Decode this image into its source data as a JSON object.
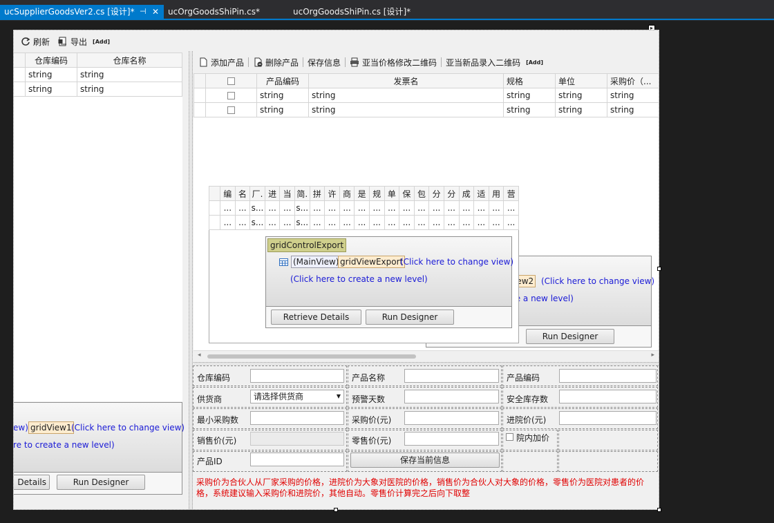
{
  "tabs": [
    {
      "label": "ucSupplierGoodsVer2.cs [设计]*",
      "active": true
    },
    {
      "label": "ucOrgGoodsShiPin.cs*",
      "active": false
    },
    {
      "label": "ucOrgGoodsShiPin.cs [设计]*",
      "active": false
    }
  ],
  "tab_icons": {
    "pin": "⊣",
    "close": "✕"
  },
  "left_toolbar": {
    "refresh": "刷新",
    "export": "导出",
    "add": "[Add]"
  },
  "warehouse_grid": {
    "columns": [
      "仓库编码",
      "仓库名称"
    ],
    "rows": [
      [
        "string",
        "string"
      ],
      [
        "string",
        "string"
      ]
    ]
  },
  "product_toolbar": {
    "add_product": "添加产品",
    "delete_product": "删除产品",
    "save_info": "保存信息",
    "modify_qr": "亚当价格修改二维码",
    "new_qr": "亚当新品录入二维码",
    "add": "[Add]"
  },
  "product_grid": {
    "columns": [
      "产品编码",
      "发票名",
      "规格",
      "单位",
      "采购价（..."
    ],
    "rows": [
      [
        "string",
        "string",
        "string",
        "string",
        "string"
      ],
      [
        "string",
        "string",
        "string",
        "string",
        "string"
      ]
    ]
  },
  "export_grid": {
    "columns": [
      "编",
      "名",
      "厂.",
      "进",
      "当",
      "简.",
      "拼",
      "许",
      "商",
      "是",
      "规",
      "单",
      "保",
      "包",
      "分",
      "分",
      "成",
      "适",
      "用",
      "营"
    ],
    "rows": [
      [
        "...",
        "...",
        "s...",
        "...",
        "...",
        "s...",
        "...",
        "...",
        "...",
        "...",
        "...",
        "...",
        "...",
        "...",
        "...",
        "...",
        "...",
        "...",
        "...",
        "..."
      ],
      [
        "...",
        "...",
        "s...",
        "...",
        "...",
        "s...",
        "...",
        "...",
        "...",
        "...",
        "...",
        "...",
        "...",
        "...",
        "...",
        "...",
        "...",
        "...",
        "...",
        "..."
      ]
    ]
  },
  "designer_export": {
    "control": "gridControlExport",
    "mainview": "(MainView)",
    "view": "gridViewExport",
    "change_view": "(Click here to change view)",
    "new_level": "(Click here to create a new level)",
    "retrieve": "Retrieve Details",
    "run": "Run Designer"
  },
  "designer_view2": {
    "view": "iew2",
    "change_view": "(Click here to change view)",
    "new_level": "te a new level)",
    "run": "Run Designer"
  },
  "designer_view1": {
    "mainview": "ew)",
    "view": "gridView1",
    "change_view": "(Click here to change view)",
    "new_level": "re to create a new level)",
    "retrieve": "Details",
    "run": "Run Designer"
  },
  "form": {
    "warehouse_code": "仓库编码",
    "product_name": "产品名称",
    "product_code": "产品编码",
    "supplier": "供货商",
    "supplier_value": "请选择供货商",
    "warn_days": "预警天数",
    "safety_stock": "安全库存数",
    "min_purchase": "最小采购数",
    "purchase_price": "采购价(元)",
    "hospital_price": "进院价(元)",
    "sale_price": "销售价(元)",
    "retail_price": "零售价(元)",
    "hospital_markup": "院内加价",
    "product_id": "产品ID",
    "save_current": "保存当前信息"
  },
  "note_text": "采购价为合伙人从厂家采购的价格，进院价为大象对医院的价格，销售价为合伙人对大象的价格，零售价为医院对患者的价格，系统建议输入采购价和进院价，其他自动。零售价计算完之后向下取整",
  "colors": {
    "accent": "#007acc",
    "note": "#e00000",
    "link": "#1a1ad6",
    "label_bg": "#cfcf8c"
  }
}
